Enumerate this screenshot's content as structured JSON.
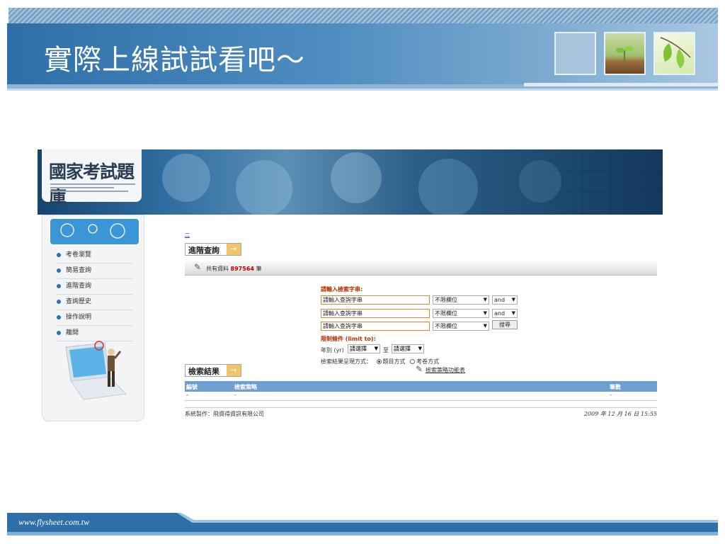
{
  "slide": {
    "title": "實際上線試試看吧～",
    "footer_url": "www.flysheet.com.tw"
  },
  "portal": {
    "logo": "國家考試題庫",
    "sidebar": [
      "考卷瀏覽",
      "簡易查詢",
      "進階查詢",
      "查詢歷史",
      "操作說明",
      "離開"
    ],
    "link": "二",
    "advanced_title": "進階查詢",
    "total_prefix": "共有資料",
    "total_count": "897564",
    "total_suffix": "筆",
    "query_label": "請輸入檢索字串:",
    "query_placeholder": "請輸入查詢字串",
    "field_option": "不限欄位",
    "operator": "and",
    "search_button": "搜尋",
    "limit_label": "限制條件 (limit to):",
    "year_label": "年別 (yr)",
    "select_placeholder": "請選擇",
    "to_label": "至",
    "display_label": "檢索結果呈現方式：",
    "display_options": [
      "題目方式",
      "考卷方式"
    ],
    "result_title": "檢索結果",
    "strategy_link": "檢索策略功能表",
    "table_headers": [
      "編號",
      "檢索策略",
      "筆數"
    ],
    "table_row": [
      "-",
      "-",
      "-"
    ],
    "maker": "系統製作：飛資得資訊有限公司",
    "date": "2009 年 12 月 16 日 15:55"
  },
  "colors": {
    "title_bar": "#2f6fa8",
    "accent_orange": "#f4c46a",
    "table_header": "#6f9fd1",
    "count_red": "#c00000"
  }
}
